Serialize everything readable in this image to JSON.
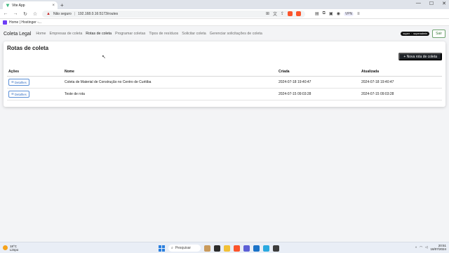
{
  "browser": {
    "tab_title": "Vite App",
    "tab_close": "×",
    "new_tab": "+",
    "window_controls": [
      "—",
      "☐",
      "✕"
    ],
    "nav": {
      "back": "←",
      "forward": "→",
      "reload": "↻"
    },
    "security_label": "Não seguro",
    "url": "192.168.0.16:5173/routes",
    "vpn_label": "VPN",
    "bookmark": "Home | Hostinger -..."
  },
  "app": {
    "brand": "Coleta Legal",
    "nav_items": [
      "Home",
      "Empresas de coleta",
      "Rotas de coleta",
      "Programar coletas",
      "Tipos de resíduos",
      "Solicitar coleta",
      "Gerenciar solicitações de coleta"
    ],
    "user_badge": [
      "super",
      "superadmin"
    ],
    "logout_label": "Sair",
    "page_title": "Rotas de coleta",
    "new_route_label": "+ Nova rota de coleta",
    "table": {
      "headers": [
        "Ações",
        "Nome",
        "Criada",
        "Atualizada"
      ],
      "details_label": "Detalhes",
      "rows": [
        {
          "name": "Coleta de Material de Construção no Centro de Curitiba",
          "created": "2024-07-18 19:40:47",
          "updated": "2024-07-18 19:40:47"
        },
        {
          "name": "Teste de rota",
          "created": "2024-07-15 09:03:28",
          "updated": "2024-07-15 09:03:28"
        }
      ]
    }
  },
  "taskbar": {
    "temperature": "18°C",
    "weather": "Limpo",
    "search_placeholder": "Pesquisar",
    "time": "20:51",
    "date": "18/07/2024"
  },
  "colors": {
    "accent_dark": "#1f2328",
    "details_blue": "#2f6ac0",
    "logout_green": "#3b7a3b",
    "brave_orange": "#fb542b"
  }
}
